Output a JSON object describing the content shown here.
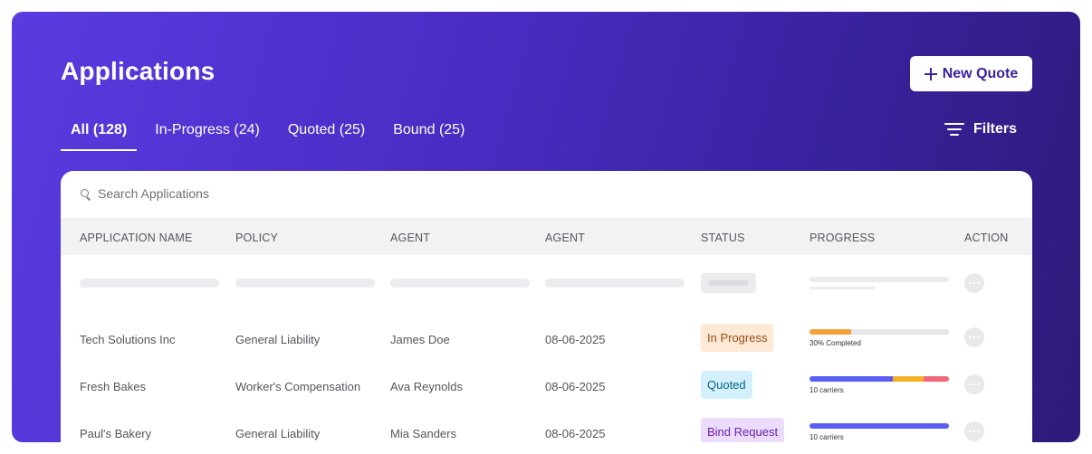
{
  "header": {
    "title": "Applications",
    "new_quote_label": "New Quote",
    "filters_label": "Filters"
  },
  "tabs": [
    {
      "label": "All (128)"
    },
    {
      "label": "In-Progress (24)"
    },
    {
      "label": "Quoted (25)"
    },
    {
      "label": "Bound (25)"
    }
  ],
  "search": {
    "placeholder": "Search Applications"
  },
  "table": {
    "columns": [
      "APPLICATION NAME",
      "POLICY",
      "AGENT",
      "AGENT",
      "STATUS",
      "PROGRESS",
      "ACTION"
    ],
    "rows": [
      {
        "name": "Tech Solutions Inc",
        "policy": "General Liability",
        "agent": "James Doe",
        "date": "08-06-2025",
        "status": "In Progress",
        "status_bg": "#fde9d6",
        "status_fg": "#9a4d12",
        "progress_caption": "30% Completed",
        "progress_percent": 30,
        "progress_segments": [
          {
            "color": "#f5a03a",
            "fraction": 0.3
          },
          {
            "color": "#e6e6e9",
            "fraction": 0.7
          }
        ]
      },
      {
        "name": "Fresh Bakes",
        "policy": "Worker's Compensation",
        "agent": "Ava Reynolds",
        "date": "08-06-2025",
        "status": "Quoted",
        "status_bg": "#d2f1fd",
        "status_fg": "#0a5f86",
        "progress_caption": "10 carriers",
        "progress_segments": [
          {
            "color": "#5b5ef2",
            "fraction": 0.6
          },
          {
            "color": "#f5b025",
            "fraction": 0.22
          },
          {
            "color": "#f2677a",
            "fraction": 0.18
          }
        ]
      },
      {
        "name": "Paul's Bakery",
        "policy": "General Liability",
        "agent": "Mia Sanders",
        "date": "08-06-2025",
        "status": "Bind Request",
        "status_bg": "#ecdcfb",
        "status_fg": "#6a1fb0",
        "progress_caption": "10 carriers",
        "progress_segments": [
          {
            "color": "#5b5ef2",
            "fraction": 1.0
          }
        ]
      }
    ]
  },
  "colors": {
    "accent": "#4a2cc4",
    "button_text": "#3b1f9e"
  }
}
